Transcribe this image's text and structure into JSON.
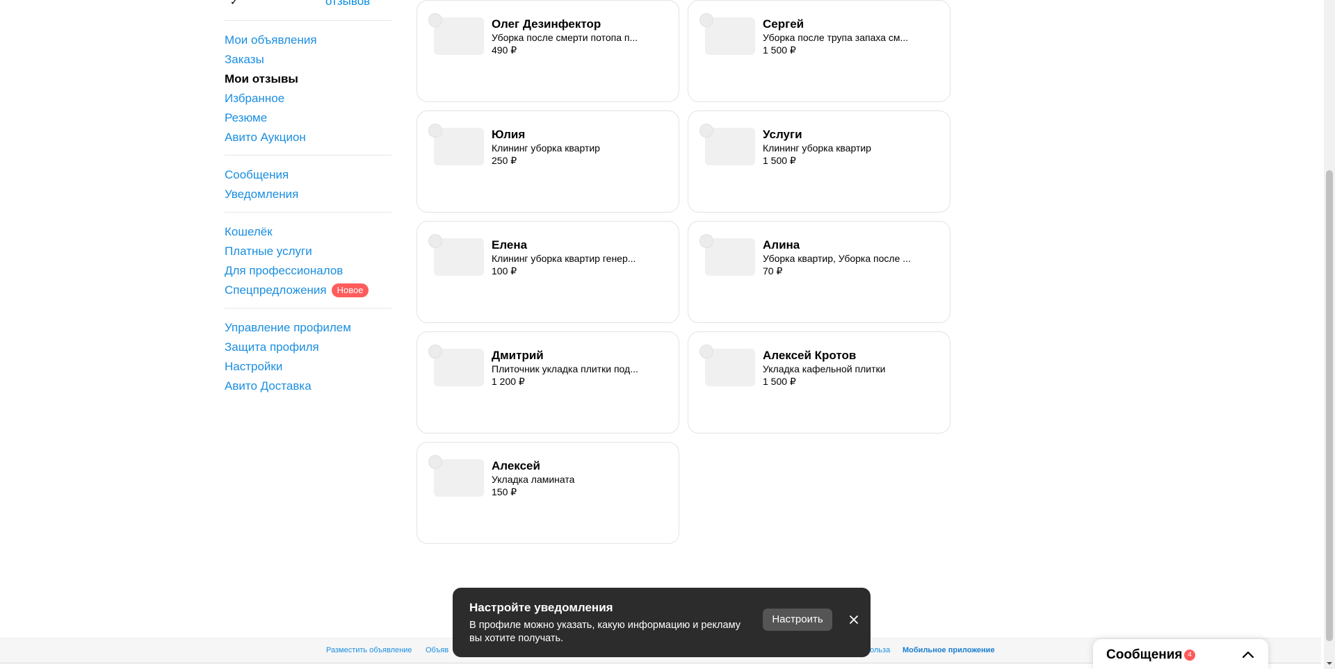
{
  "sidebar": {
    "top_mark": "✓",
    "top_reviews_link": "отзывов",
    "groups": [
      {
        "items": [
          {
            "label": "Мои объявления",
            "active": false
          },
          {
            "label": "Заказы",
            "active": false
          },
          {
            "label": "Мои отзывы",
            "active": true
          },
          {
            "label": "Избранное",
            "active": false
          },
          {
            "label": "Резюме",
            "active": false
          },
          {
            "label": "Авито Аукцион",
            "active": false
          }
        ]
      },
      {
        "items": [
          {
            "label": "Сообщения"
          },
          {
            "label": "Уведомления"
          }
        ]
      },
      {
        "items": [
          {
            "label": "Кошелёк"
          },
          {
            "label": "Платные услуги"
          },
          {
            "label": "Для профессионалов"
          },
          {
            "label": "Спецпредложения",
            "badge": "Новое"
          }
        ]
      },
      {
        "items": [
          {
            "label": "Управление профилем"
          },
          {
            "label": "Защита профиля"
          },
          {
            "label": "Настройки"
          },
          {
            "label": "Авито Доставка"
          }
        ]
      }
    ]
  },
  "cards": [
    {
      "name": "Олег Дезинфектор",
      "desc": "Уборка после смерти потопа п...",
      "price": "490 ₽"
    },
    {
      "name": "Сергей",
      "desc": "Уборка после трупа запаха см...",
      "price": "1 500 ₽"
    },
    {
      "name": "Юлия",
      "desc": "Клининг уборка квартир",
      "price": "250 ₽"
    },
    {
      "name": "Услуги",
      "desc": "Клининг уборка квартир",
      "price": "1 500 ₽"
    },
    {
      "name": "Елена",
      "desc": "Клининг уборка квартир генер...",
      "price": "100 ₽"
    },
    {
      "name": "Алина",
      "desc": "Уборка квартир, Уборка после ...",
      "price": "70 ₽"
    },
    {
      "name": "Дмитрий",
      "desc": "Плиточник укладка плитки под...",
      "price": "1 200 ₽"
    },
    {
      "name": "Алексей Кротов",
      "desc": "Укладка кафельной плитки",
      "price": "1 500 ₽"
    },
    {
      "name": "Алексей",
      "desc": "Укладка ламината",
      "price": "150 ₽"
    }
  ],
  "footer": {
    "links": [
      {
        "label": "Разместить объявление"
      },
      {
        "label": "Объяв"
      },
      {
        "label": "ольза"
      },
      {
        "label": "Мобильное приложение",
        "bold": true
      }
    ]
  },
  "toast": {
    "title": "Настройте уведомления",
    "body": "В профиле можно указать, какую информацию и рекламу вы хотите получать.",
    "button": "Настроить",
    "close_icon": "close-icon"
  },
  "messenger": {
    "title": "Сообщения",
    "count": "4",
    "chevron_icon": "chevron-up-icon"
  }
}
